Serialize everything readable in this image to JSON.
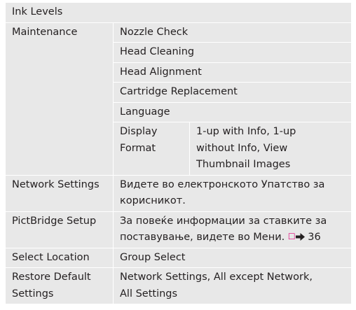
{
  "rows": {
    "ink_levels": {
      "label": "Ink Levels"
    },
    "maintenance": {
      "label": "Maintenance",
      "items": {
        "nozzle_check": "Nozzle Check",
        "head_cleaning": "Head Cleaning",
        "head_alignment": "Head Alignment",
        "cartridge_replacement": "Cartridge Replacement",
        "language": "Language"
      },
      "display_format": {
        "label_line1": "Display",
        "label_line2": "Format",
        "options_line1": "1-up with Info, 1-up",
        "options_line2": "without Info, View",
        "options_line3": "Thumbnail Images"
      }
    },
    "network_settings": {
      "label": "Network Settings",
      "desc_line1": "Видете во електронското Упатство за",
      "desc_line2": "корисникот."
    },
    "pictbridge_setup": {
      "label": "PictBridge Setup",
      "desc_line1": "За повеќе информации за ставките за",
      "desc_line2": "поставување, видете во Мени.",
      "page_ref": "36",
      "book_icon": "book-icon",
      "arrow_icon": "right-arrow-icon"
    },
    "select_location": {
      "label": "Select Location",
      "value": "Group Select"
    },
    "restore_default": {
      "label_line1": "Restore Default",
      "label_line2": "Settings",
      "desc_line1": "Network Settings, All except Network,",
      "desc_line2": "All Settings"
    }
  },
  "colors": {
    "cell_background": "#e8e8e8",
    "text": "#231f20",
    "icon_accent": "#e2007a"
  }
}
